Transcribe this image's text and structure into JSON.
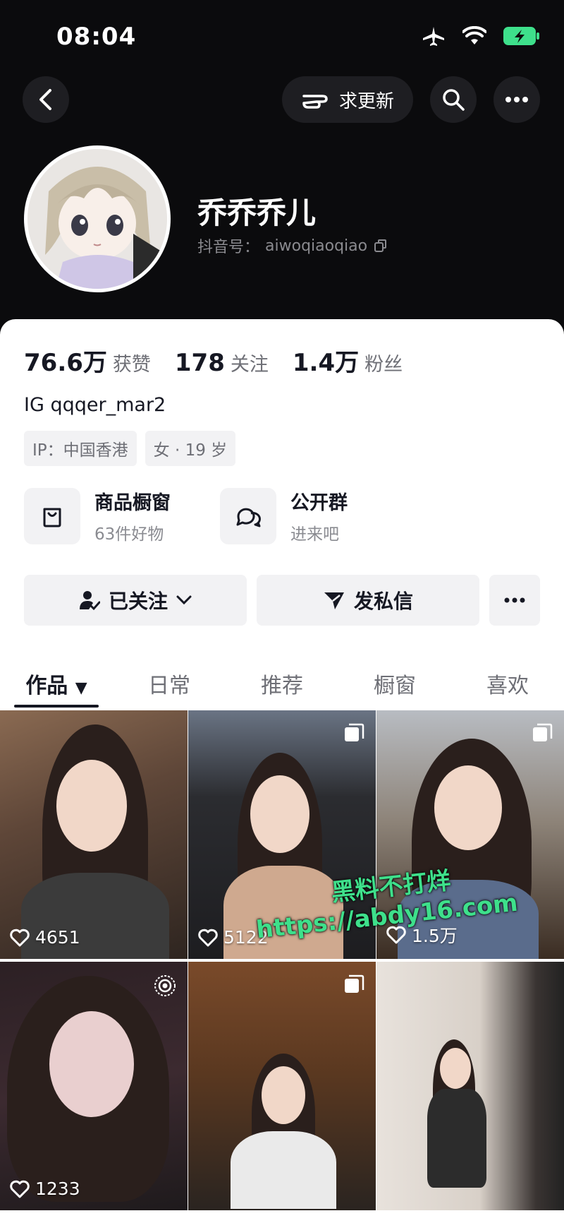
{
  "status": {
    "time": "08:04",
    "icons": [
      "airplane-icon",
      "wifi-icon",
      "battery-charging-icon"
    ]
  },
  "header": {
    "update_label": "求更新"
  },
  "profile": {
    "name": "乔乔乔儿",
    "id_label": "抖音号：",
    "id_value": "aiwoqiaoqiao"
  },
  "stats": [
    {
      "value": "76.6万",
      "label": "获赞"
    },
    {
      "value": "178",
      "label": "关注"
    },
    {
      "value": "1.4万",
      "label": "粉丝"
    }
  ],
  "bio": "IG qqqer_mar2",
  "tags": [
    "IP：中国香港",
    "女 · 19 岁"
  ],
  "entries": {
    "shop": {
      "title": "商品橱窗",
      "sub": "63件好物"
    },
    "group": {
      "title": "公开群",
      "sub": "进来吧"
    }
  },
  "actions": {
    "follow": "已关注",
    "message": "发私信"
  },
  "tabs": [
    "作品",
    "日常",
    "推荐",
    "橱窗",
    "喜欢"
  ],
  "videos": [
    {
      "likes": "4651",
      "badge": ""
    },
    {
      "likes": "5122",
      "badge": "collection-icon"
    },
    {
      "likes": "1.5万",
      "badge": "collection-icon"
    },
    {
      "likes": "1233",
      "badge": "live-photo-icon"
    },
    {
      "likes": "",
      "badge": "collection-icon"
    },
    {
      "likes": "",
      "badge": ""
    }
  ],
  "watermark": {
    "line1": "黑料不打烊",
    "line2": "https://abdy16.com"
  },
  "colors": {
    "background": "#0b0b0d",
    "watermark": "#3ee08b",
    "battery": "#3ee08b"
  }
}
